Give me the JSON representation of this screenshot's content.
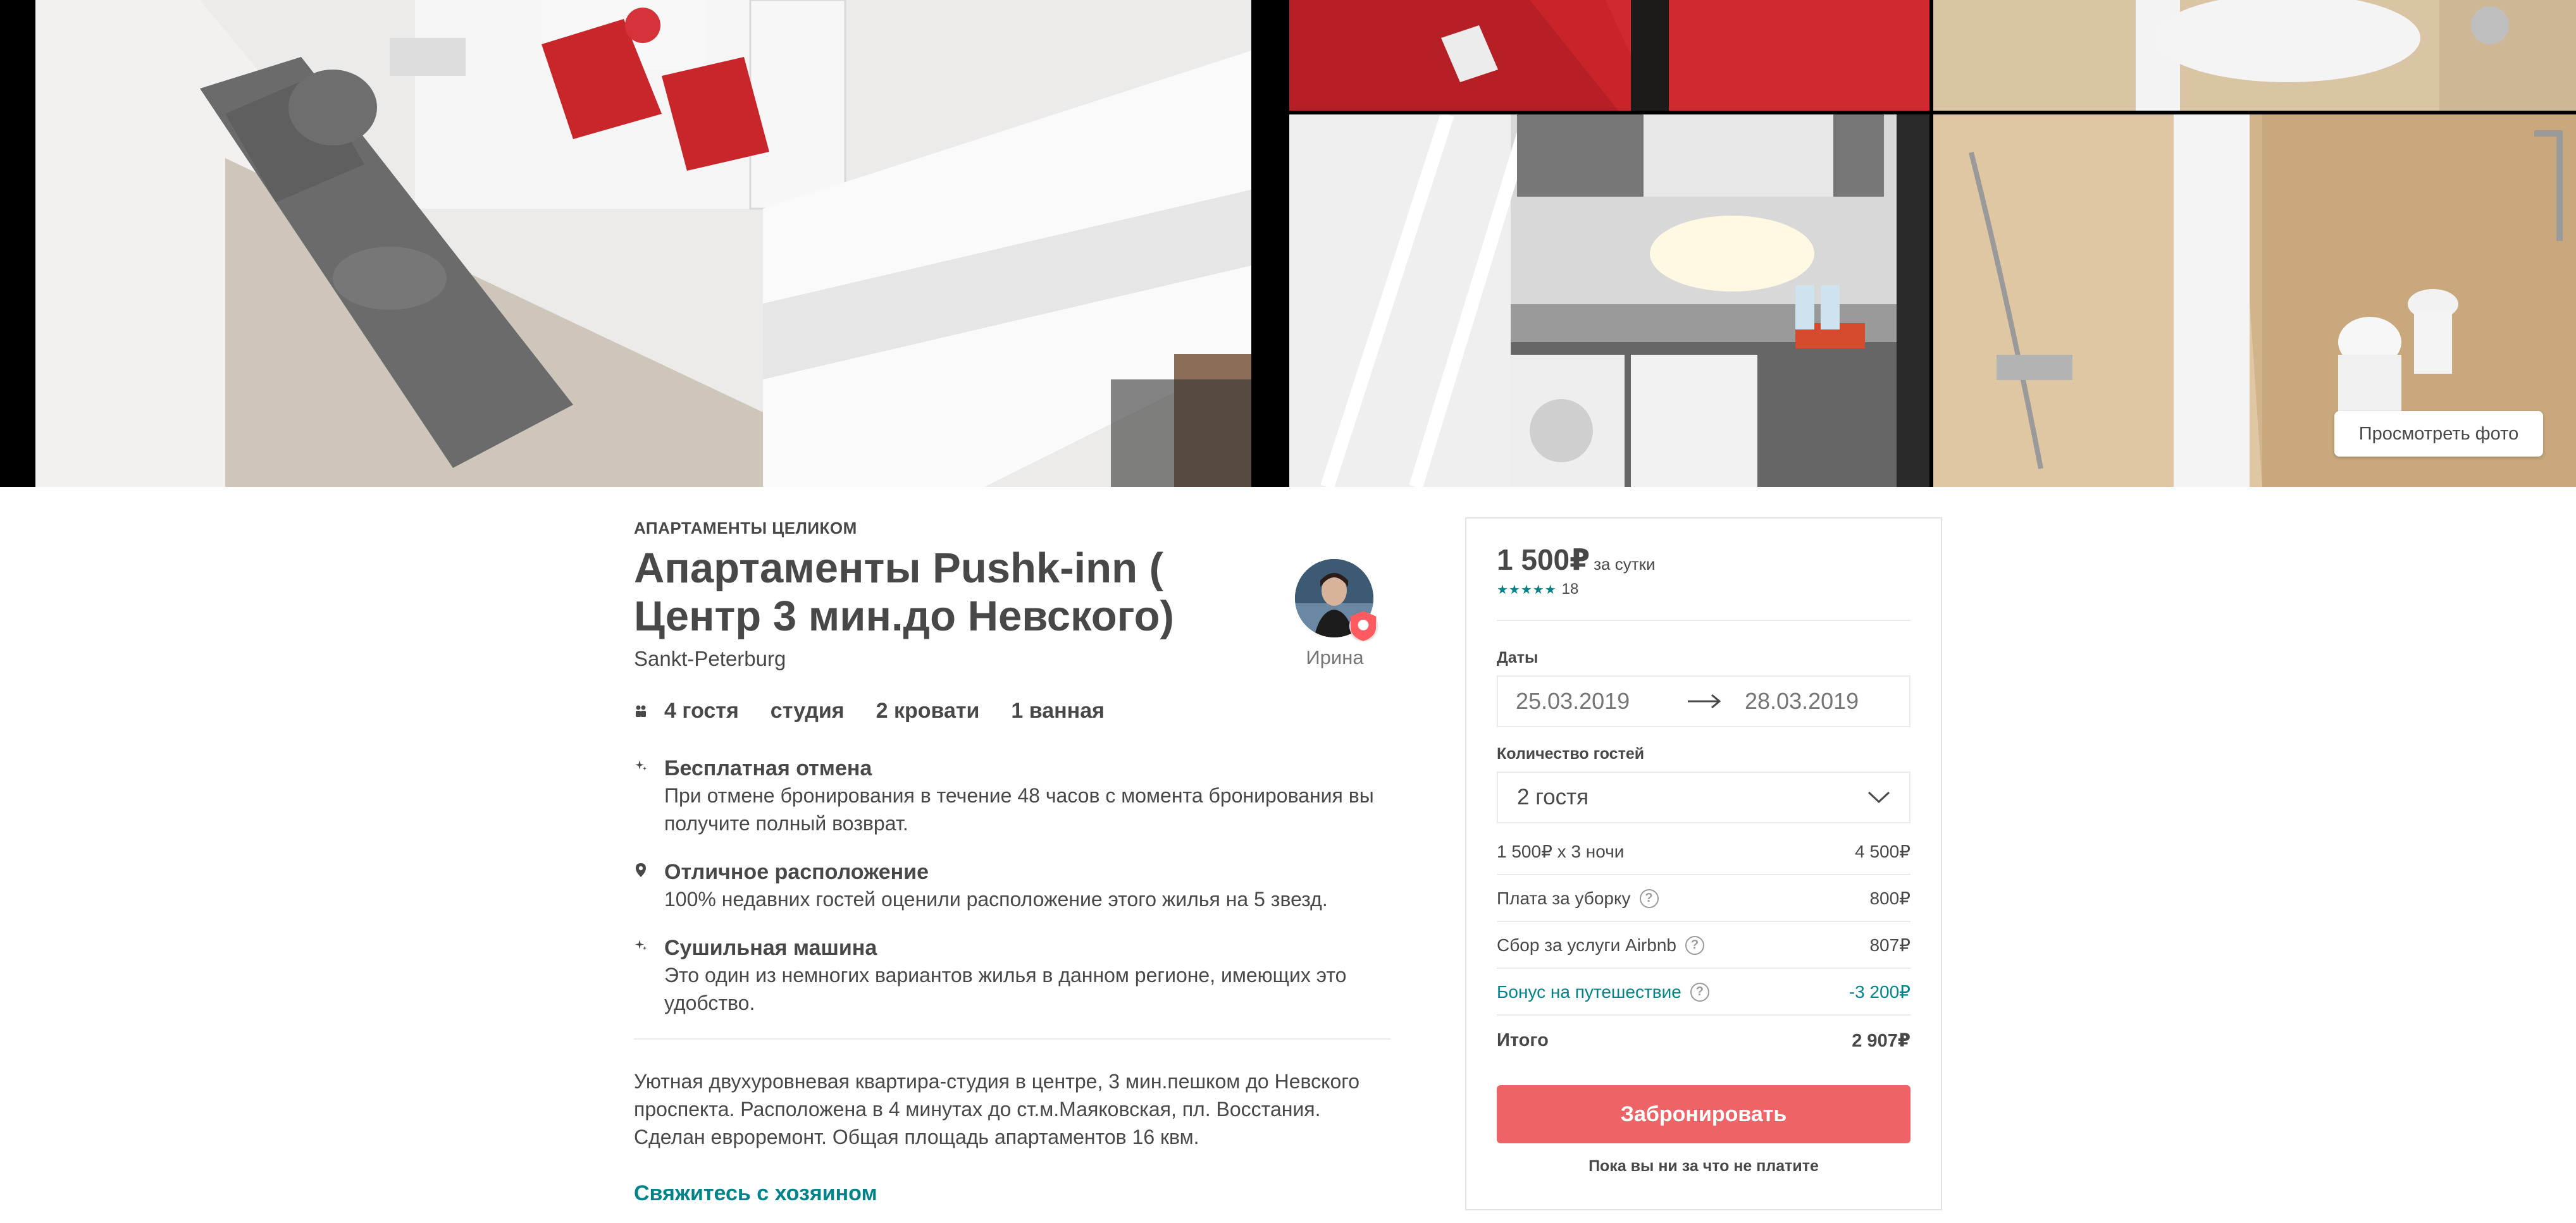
{
  "gallery": {
    "view_photos_label": "Просмотреть фото"
  },
  "listing": {
    "kicker": "АПАРТАМЕНТЫ ЦЕЛИКОМ",
    "title": "Апартаменты Pushk-inn ( Центр 3 мин.до Невского)",
    "city": "Sankt-Peterburg",
    "host_name": "Ирина",
    "amenities": {
      "guests": "4 гостя",
      "type": "студия",
      "beds": "2 кровати",
      "baths": "1 ванная"
    },
    "highlights": [
      {
        "icon": "sparkle-icon",
        "title": "Бесплатная отмена",
        "text": "При отмене бронирования в течение 48 часов с момента бронирования вы получите полный возврат."
      },
      {
        "icon": "map-pin-icon",
        "title": "Отличное расположение",
        "text": "100% недавних гостей оценили расположение этого жилья на 5 звезд."
      },
      {
        "icon": "sparkle-icon",
        "title": "Сушильная машина",
        "text": "Это один из немногих вариантов жилья в данном регионе, имеющих это удобство."
      }
    ],
    "description": "Уютная двухуровневая квартира-студия в центре, 3 мин.пешком до Невского проспекта. Расположена в 4 минутах до ст.м.Маяковская, пл. Восстания. Сделан евроремонт. Общая площадь апартаментов 16 квм.",
    "contact_host_label": "Свяжитесь с хозяином"
  },
  "booking": {
    "price": "1 500₽",
    "per_night": "за сутки",
    "stars": "★★★★★",
    "review_count": "18",
    "dates_label": "Даты",
    "check_in": "25.03.2019",
    "check_out": "28.03.2019",
    "guests_label": "Количество гостей",
    "guests_value": "2 гостя",
    "fees": {
      "nights_label": "1 500₽ x 3 ночи",
      "nights_value": "4 500₽",
      "cleaning_label": "Плата за уборку",
      "cleaning_value": "800₽",
      "service_label": "Сбор за услуги Airbnb",
      "service_value": "807₽",
      "bonus_label": "Бонус на путешествие",
      "bonus_value": "-3 200₽",
      "total_label": "Итого",
      "total_value": "2 907₽"
    },
    "book_label": "Забронировать",
    "no_charge": "Пока вы ни за что не платите"
  },
  "colors": {
    "accent_teal": "#008489",
    "book_button": "#ee6366",
    "text": "#484848"
  }
}
